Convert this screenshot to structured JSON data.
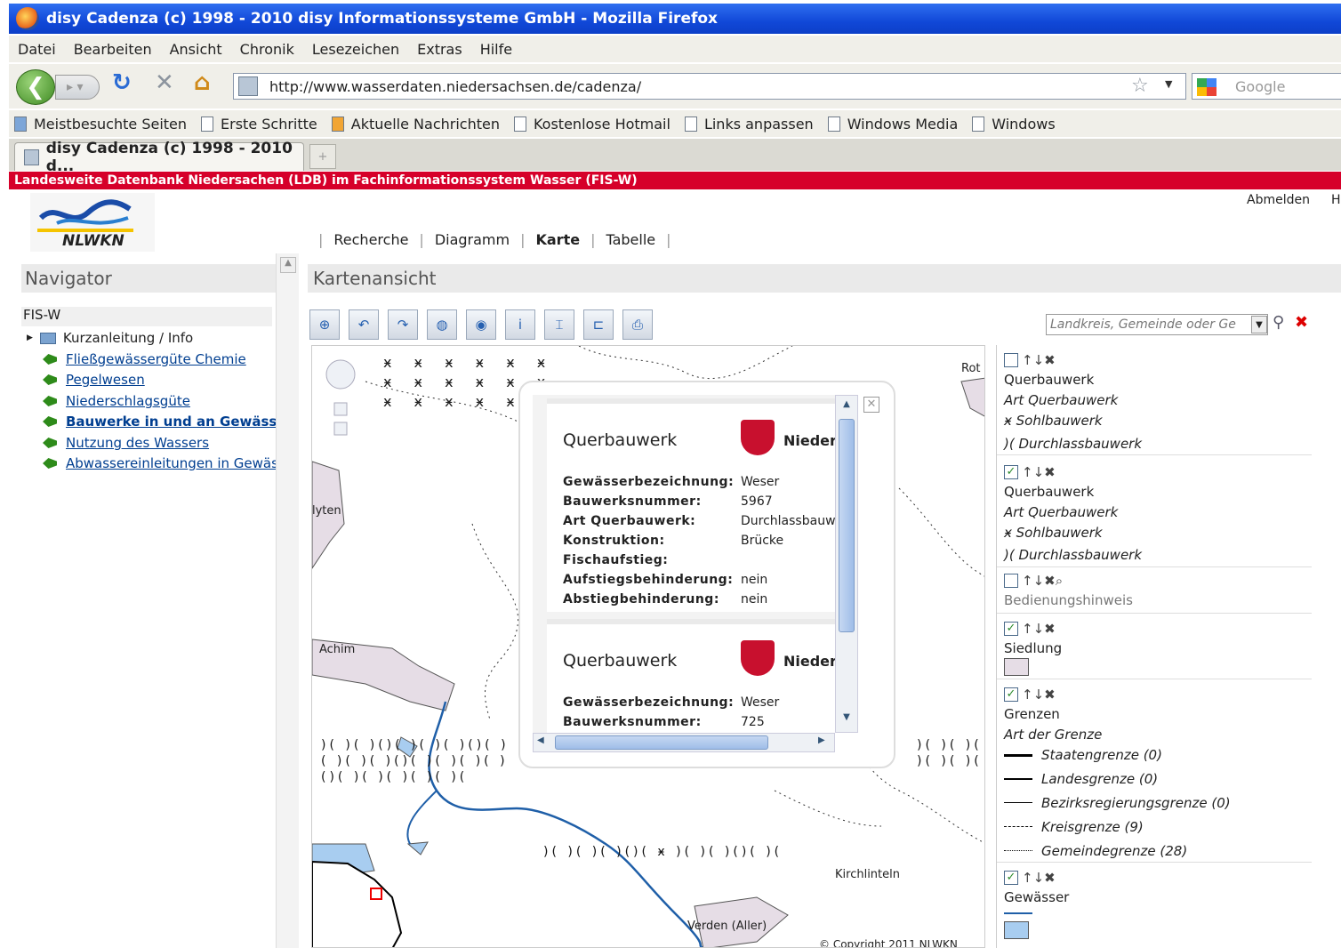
{
  "window": {
    "title": "disy Cadenza (c) 1998 - 2010 disy Informationssysteme GmbH - Mozilla Firefox"
  },
  "menu": [
    "Datei",
    "Bearbeiten",
    "Ansicht",
    "Chronik",
    "Lesezeichen",
    "Extras",
    "Hilfe"
  ],
  "navigation": {
    "url": "http://www.wasserdaten.niedersachsen.de/cadenza/",
    "search_placeholder": "Google"
  },
  "bookmarks": [
    "Meistbesuchte Seiten",
    "Erste Schritte",
    "Aktuelle Nachrichten",
    "Kostenlose Hotmail",
    "Links anpassen",
    "Windows Media",
    "Windows"
  ],
  "tab": {
    "title": "disy Cadenza (c) 1998 - 2010 d..."
  },
  "banner": "Landesweite Datenbank Niedersachen (LDB) im Fachinformationssystem Wasser (FIS-W)",
  "header": {
    "logo_text": "NLWKN",
    "logout": "Abmelden",
    "help": "H",
    "nav": [
      "Recherche",
      "Diagramm",
      "Karte",
      "Tabelle"
    ]
  },
  "navigator": {
    "title": "Navigator",
    "root": "FIS-W",
    "folder": "Kurzanleitung / Info",
    "items": [
      "Fließgewässergüte Chemie",
      "Pegelwesen",
      "Niederschlagsgüte",
      "Bauwerke in und an Gewäss",
      "Nutzung des Wassers",
      "Abwassereinleitungen in Gewäs"
    ]
  },
  "map": {
    "title": "Kartenansicht",
    "place_placeholder": "Landkreis, Gemeinde oder Ge",
    "labels": {
      "rot": "Rot",
      "lyten": "lyten",
      "achim": "Achim",
      "kirch": "Kirchlinteln",
      "verden": "Verden (Aller)",
      "copyright": "© Copyright 2011 NLWKN"
    }
  },
  "popup": {
    "cards": [
      {
        "title": "Querbauwerk",
        "land": "Niedersa",
        "rows": [
          [
            "Gewässerbezeichnung:",
            "Weser"
          ],
          [
            "Bauwerksnummer:",
            "5967"
          ],
          [
            "Art Querbauwerk:",
            "Durchlassbauwe"
          ],
          [
            "Konstruktion:",
            "Brücke"
          ],
          [
            "Fischaufstieg:",
            ""
          ],
          [
            "Aufstiegsbehinderung:",
            "nein"
          ],
          [
            "Abstiegbehinderung:",
            "nein"
          ]
        ]
      },
      {
        "title": "Querbauwerk",
        "land": "Niedersa",
        "rows": [
          [
            "Gewässerbezeichnung:",
            "Weser"
          ],
          [
            "Bauwerksnummer:",
            "725"
          ]
        ]
      }
    ]
  },
  "legend": {
    "groups": [
      {
        "checked": false,
        "name": "Querbauwerk",
        "sub": "Art Querbauwerk",
        "items": [
          "Sohlbauwerk",
          "Durchlassbauwerk"
        ]
      },
      {
        "checked": true,
        "name": "Querbauwerk",
        "sub": "Art Querbauwerk",
        "items": [
          "Sohlbauwerk",
          "Durchlassbauwerk"
        ]
      },
      {
        "checked": false,
        "name": "Bedienungshinweis"
      },
      {
        "checked": true,
        "name": "Siedlung"
      },
      {
        "checked": true,
        "name": "Grenzen",
        "sub": "Art der Grenze",
        "items": [
          "Staatengrenze (0)",
          "Landesgrenze (0)",
          "Bezirksregierungsgrenze (0)",
          "Kreisgrenze (9)",
          "Gemeindegrenze (28)"
        ]
      },
      {
        "checked": true,
        "name": "Gewässer"
      }
    ]
  },
  "colors": {
    "banner": "#d6002a",
    "titlebar": "#1148d8",
    "siedlung": "#e6dde6",
    "gewaesser": "#a8cdf0",
    "river": "#1f5fa8"
  }
}
